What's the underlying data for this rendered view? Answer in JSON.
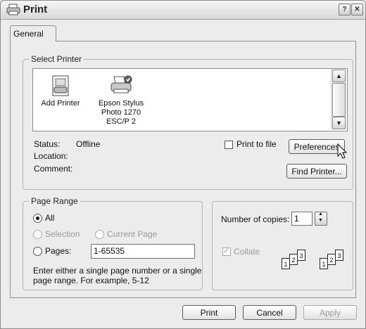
{
  "window": {
    "title": "Print"
  },
  "tabs": [
    "General"
  ],
  "select_printer": {
    "legend": "Select Printer",
    "printers": [
      {
        "name": "Add Printer",
        "icon": "add-printer-icon"
      },
      {
        "name": "Epson Stylus Photo 1270 ESC/P 2",
        "line1": "Epson Stylus",
        "line2": "Photo 1270",
        "line3": "ESC/P 2",
        "icon": "printer-icon"
      }
    ],
    "status_label": "Status:",
    "status_value": "Offline",
    "location_label": "Location:",
    "comment_label": "Comment:",
    "print_to_file_label": "Print to file",
    "preferences_label": "Preferences",
    "find_printer_label": "Find Printer..."
  },
  "page_range": {
    "legend": "Page Range",
    "all_label": "All",
    "selection_label": "Selection",
    "current_page_label": "Current Page",
    "pages_label": "Pages:",
    "pages_value": "1-65535",
    "hint_line1": "Enter either a single page number or a single",
    "hint_line2": "page range.  For example, 5-12"
  },
  "copies": {
    "label": "Number of copies:",
    "value": "1",
    "collate_label": "Collate",
    "collate_pages": [
      "1",
      "2",
      "3"
    ]
  },
  "footer": {
    "print": "Print",
    "cancel": "Cancel",
    "apply": "Apply"
  }
}
